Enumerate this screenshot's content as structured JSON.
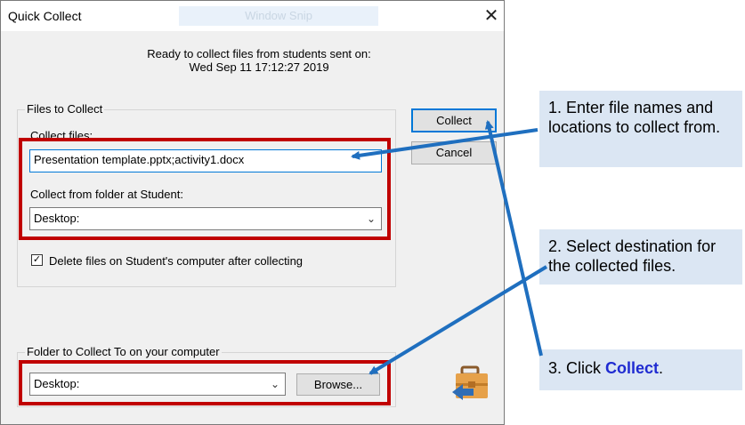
{
  "window": {
    "title": "Quick Collect",
    "ghost_label": "Window Snip",
    "close_glyph": "✕"
  },
  "status": {
    "line1": "Ready to collect files from students sent on:",
    "line2": "Wed Sep 11 17:12:27 2019"
  },
  "files_group": {
    "legend": "Files to Collect",
    "collect_files_label": "Collect files:",
    "collect_files_value": "Presentation template.pptx;activity1.docx",
    "folder_label": "Collect from folder at Student:",
    "folder_value": "Desktop:",
    "delete_checkbox_checked": true,
    "delete_checkbox_label": "Delete files on Student's computer after collecting"
  },
  "dest_group": {
    "legend": "Folder to Collect To on your computer",
    "folder_value": "Desktop:",
    "browse_label": "Browse..."
  },
  "buttons": {
    "collect": "Collect",
    "cancel": "Cancel"
  },
  "icons": {
    "collect_icon": "briefcase-arrow-icon"
  },
  "callouts": {
    "c1": "1. Enter file names and locations to collect from.",
    "c2": "2. Select destination for the collected files.",
    "c3_prefix": "3. Click ",
    "c3_highlight": "Collect",
    "c3_suffix": "."
  },
  "colors": {
    "annotation_red": "#c00000",
    "arrow_blue": "#1f6fbf",
    "callout_bg": "#dbe6f3",
    "highlight_blue": "#1f2bd1"
  }
}
